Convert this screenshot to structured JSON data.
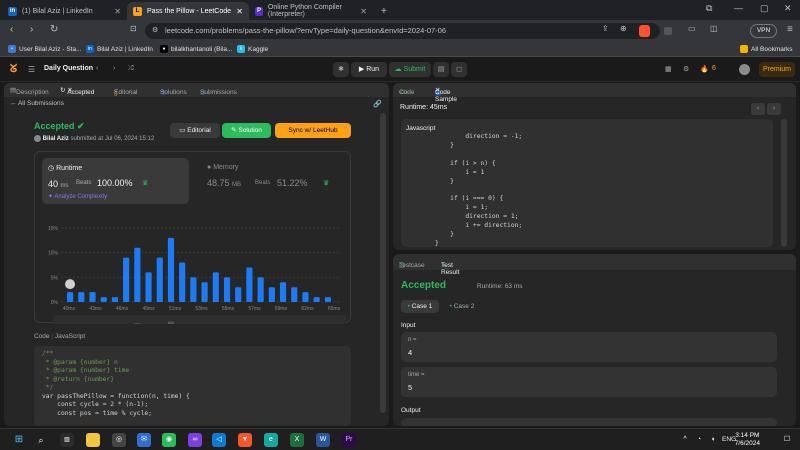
{
  "browser": {
    "tabs": [
      {
        "label": "(1) Bilal Aziz | LinkedIn",
        "icon": "linkedin-icon"
      },
      {
        "label": "Pass the Pillow - LeetCode",
        "icon": "leetcode-icon"
      },
      {
        "label": "Online Python Compiler (Interpreter)",
        "icon": "programiz-icon"
      }
    ],
    "new_tab": "+",
    "url": "leetcode.com/problems/pass-the-pillow/?envType=daily-question&envId=2024-07-06",
    "vpn": "VPN",
    "bookmarks": [
      "User Bilal Aziz - Sta...",
      "Bilal Aziz | LinkedIn",
      "bilalkhantanoli (Bila...",
      "Kaggle"
    ],
    "all_bookmarks": "All Bookmarks"
  },
  "leetcode_header": {
    "daily_question": "Daily Question",
    "run": "Run",
    "submit": "Submit",
    "streak": "6",
    "premium": "Premium"
  },
  "left_panel": {
    "tabs": [
      "Description",
      "Accepted",
      "Editorial",
      "Solutions",
      "Submissions"
    ],
    "all_submissions": "All Submissions",
    "status": "Accepted",
    "author": "Bilal Aziz",
    "submitted_text": "submitted at Jul 06, 2024 15:12",
    "editorial_btn": "Editorial",
    "solution_btn": "Solution",
    "sync_btn": "Sync w/ LeetHub",
    "runtime_label": "Runtime",
    "runtime_value": "40",
    "runtime_unit": "ms",
    "beats_label": "Beats",
    "runtime_beats": "100.00%",
    "analyze": "Analyze Complexity",
    "memory_label": "Memory",
    "memory_value": "48.75",
    "memory_unit": "MB",
    "memory_beats": "51.22%",
    "code_label": "Code",
    "code_lang": "JavaScript",
    "code_lines": [
      "/**",
      " * @param {number} n",
      " * @param {number} time",
      " * @return {number}",
      " */",
      "var passThePillow = function(n, time) {",
      "    const cycle = 2 * (n-1);",
      "    const pos = time % cycle;"
    ]
  },
  "chart_data": {
    "type": "bar",
    "ylim": [
      0,
      15
    ],
    "yticks": [
      "15%",
      "10%",
      "5%",
      "0%"
    ],
    "xtick_labels": [
      "40ms",
      "43ms",
      "46ms",
      "49ms",
      "51ms",
      "53ms",
      "55ms",
      "57ms",
      "59ms",
      "62ms",
      "65ms"
    ],
    "values": [
      2,
      2,
      2,
      1,
      1,
      9,
      11,
      6,
      9,
      13,
      8,
      5,
      4,
      6,
      5,
      3,
      7,
      5,
      3,
      4,
      3,
      2,
      1,
      1
    ],
    "highlight_index": 0,
    "grid": true
  },
  "right_top": {
    "tabs": [
      "Code",
      "Code Sample"
    ],
    "runtime": "Runtime: 45ms",
    "lang": "Javascript",
    "code_lines": [
      "        direction = -1;",
      "    }",
      "",
      "    if (i > n) {",
      "        i = 1",
      "    }",
      "",
      "    if (i === 0) {",
      "        i = 1;",
      "        direction = 1;",
      "        i += direction;",
      "    }",
      "}"
    ]
  },
  "right_bottom": {
    "tabs": [
      "Testcase",
      "Test Result"
    ],
    "status": "Accepted",
    "runtime": "Runtime: 63 ms",
    "cases": [
      "Case 1",
      "Case 2"
    ],
    "input_label": "Input",
    "n_label": "n =",
    "n_value": "4",
    "time_label": "time =",
    "time_value": "5",
    "output_label": "Output"
  },
  "taskbar": {
    "lang": "ENG",
    "time": "3:14 PM",
    "date": "7/6/2024"
  },
  "colors": {
    "accent": "#2cbb5d",
    "bar": "#1c7cf5",
    "highlight": "#ffa116"
  }
}
